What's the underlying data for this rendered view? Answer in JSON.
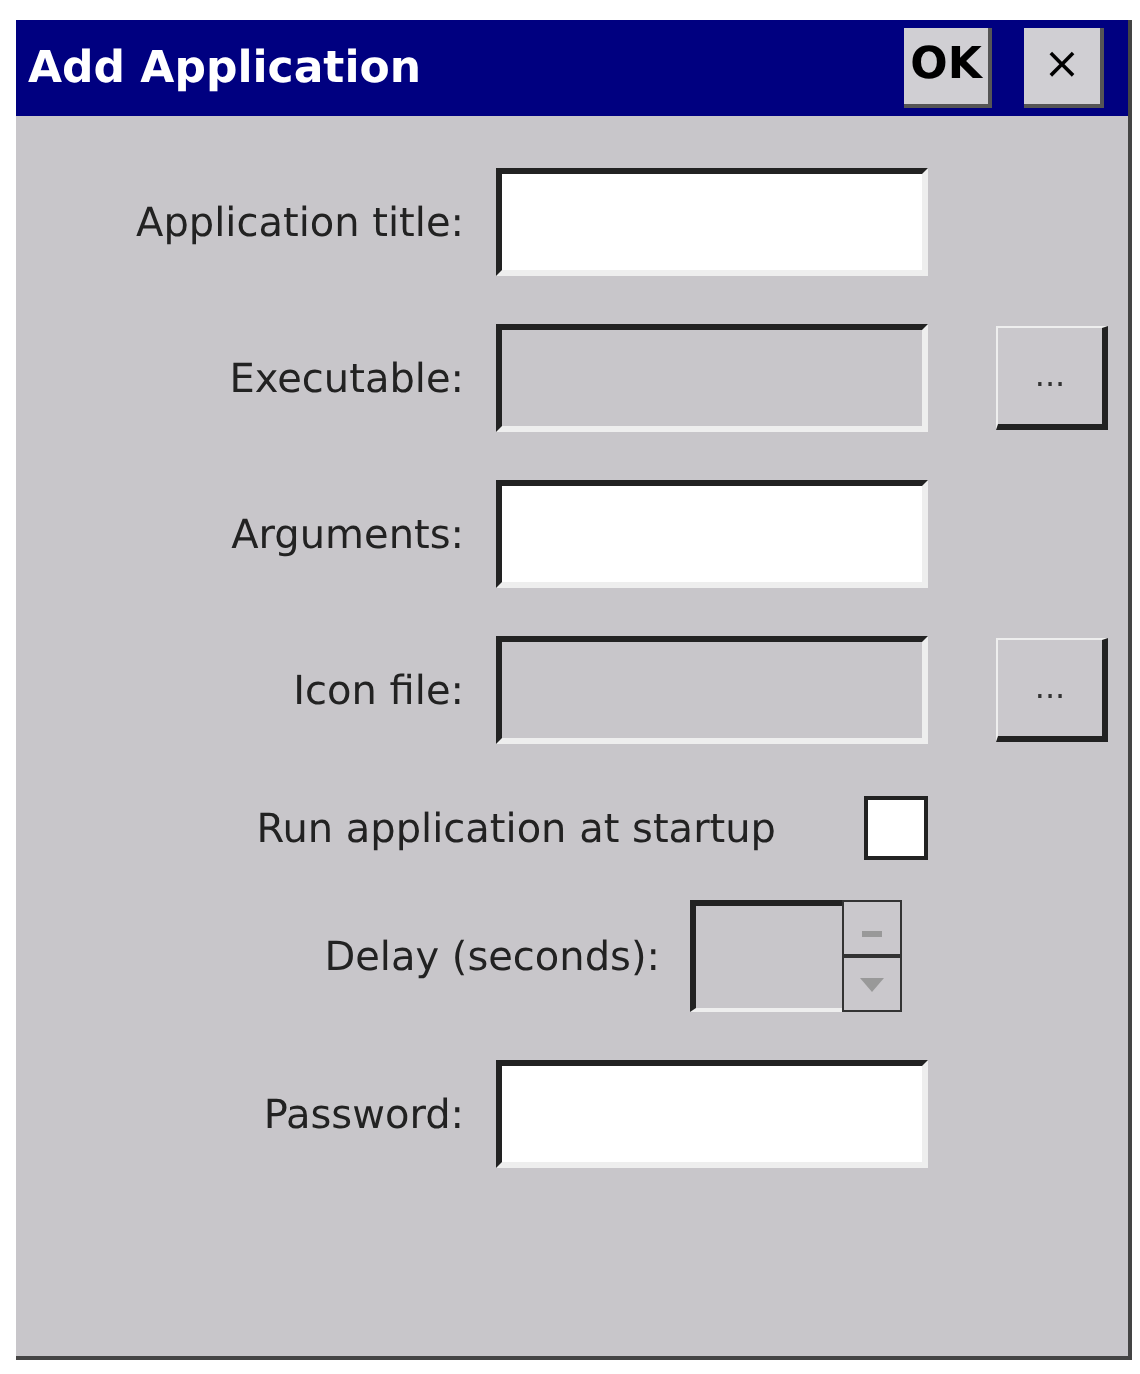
{
  "window": {
    "title": "Add Application",
    "ok_button": "OK",
    "close_button": "×"
  },
  "rows": [
    {
      "kind": "text",
      "label": "Application title:",
      "disabled": false
    },
    {
      "kind": "browse",
      "label": "Executable:",
      "disabled": true,
      "button": "..."
    },
    {
      "kind": "text",
      "label": "Arguments:",
      "disabled": false
    },
    {
      "kind": "browse",
      "label": "Icon file:",
      "disabled": true,
      "button": "..."
    },
    {
      "kind": "checkbox",
      "label": "Run application at startup",
      "checked": false
    },
    {
      "kind": "spinner",
      "label": "Delay (seconds):",
      "disabled": true
    },
    {
      "kind": "text",
      "label": "Password:",
      "disabled": false
    }
  ]
}
